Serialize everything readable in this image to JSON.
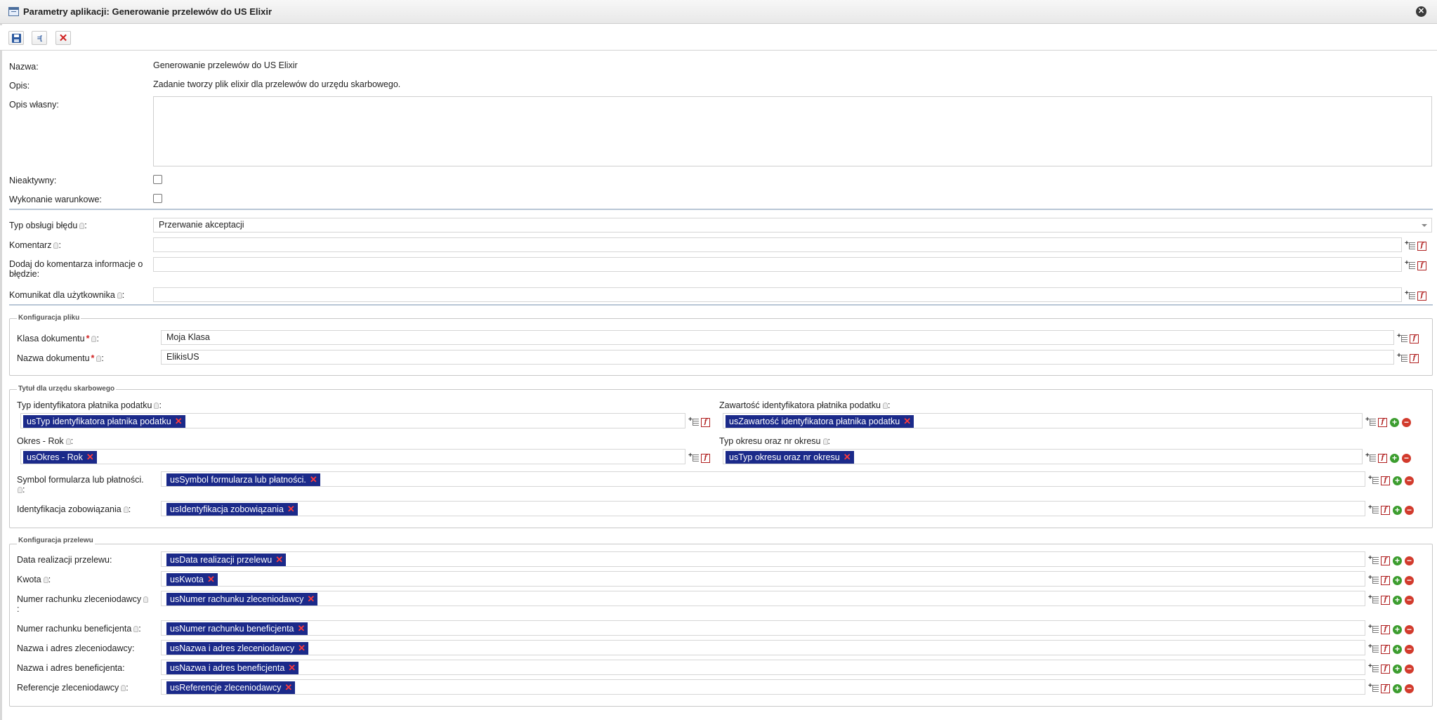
{
  "window": {
    "title": "Parametry aplikacji: Generowanie przelewów do US Elixir"
  },
  "form": {
    "nazwa_label": "Nazwa:",
    "nazwa_value": "Generowanie przelewów do US Elixir",
    "opis_label": "Opis:",
    "opis_value": "Zadanie tworzy plik elixir dla przelewów do urzędu skarbowego.",
    "opis_wlasny_label": "Opis własny:",
    "nieaktywny_label": "Nieaktywny:",
    "wykonanie_label": "Wykonanie warunkowe:"
  },
  "error": {
    "typ_label": "Typ obsługi błędu",
    "typ_value": "Przerwanie akceptacji",
    "komentarz_label": "Komentarz",
    "dodaj_label": "Dodaj do komentarza informacje o błędzie:",
    "komunikat_label": "Komunikat dla użytkownika"
  },
  "plik": {
    "legend": "Konfiguracja pliku",
    "klasa_label": "Klasa dokumentu",
    "klasa_value": "Moja Klasa",
    "nazwa_label": "Nazwa dokumentu",
    "nazwa_value": "ElikisUS"
  },
  "tytul": {
    "legend": "Tytuł dla urzędu skarbowego",
    "typ_id_label": "Typ identyfikatora płatnika podatku",
    "typ_id_tag": "usTyp identyfikatora płatnika podatku",
    "zawartosc_label": "Zawartość identyfikatora płatnika podatku",
    "zawartosc_tag": "usZawartość identyfikatora płatnika podatku",
    "okres_label": "Okres - Rok",
    "okres_tag": "usOkres - Rok",
    "typ_okresu_label": "Typ okresu oraz nr okresu",
    "typ_okresu_tag": "usTyp okresu oraz nr okresu",
    "symbol_label": "Symbol formularza lub płatności.",
    "symbol_tag": "usSymbol formularza lub płatności.",
    "ident_label": "Identyfikacja zobowiązania",
    "ident_tag": "usIdentyfikacja zobowiązania"
  },
  "przelew": {
    "legend": "Konfiguracja przelewu",
    "data_label": "Data realizacji przelewu:",
    "data_tag": "usData realizacji przelewu",
    "kwota_label": "Kwota",
    "kwota_tag": "usKwota",
    "numer_zlec_label": "Numer rachunku zleceniodawcy",
    "numer_zlec_tag": "usNumer rachunku zleceniodawcy",
    "numer_ben_label": "Numer rachunku beneficjenta",
    "numer_ben_tag": "usNumer rachunku beneficjenta",
    "nazwa_zlec_label": "Nazwa i adres zleceniodawcy:",
    "nazwa_zlec_tag": "usNazwa i adres zleceniodawcy",
    "nazwa_ben_label": "Nazwa i adres beneficjenta:",
    "nazwa_ben_tag": "usNazwa i adres beneficjenta",
    "ref_label": "Referencje zleceniodawcy",
    "ref_tag": "usReferencje zleceniodawcy"
  },
  "symbols": {
    "colon": ":",
    "required": "*",
    "tag_remove": "✕",
    "close": "✕",
    "add": "+",
    "remove": "−",
    "fn": "f",
    "save_close": "≡["
  }
}
